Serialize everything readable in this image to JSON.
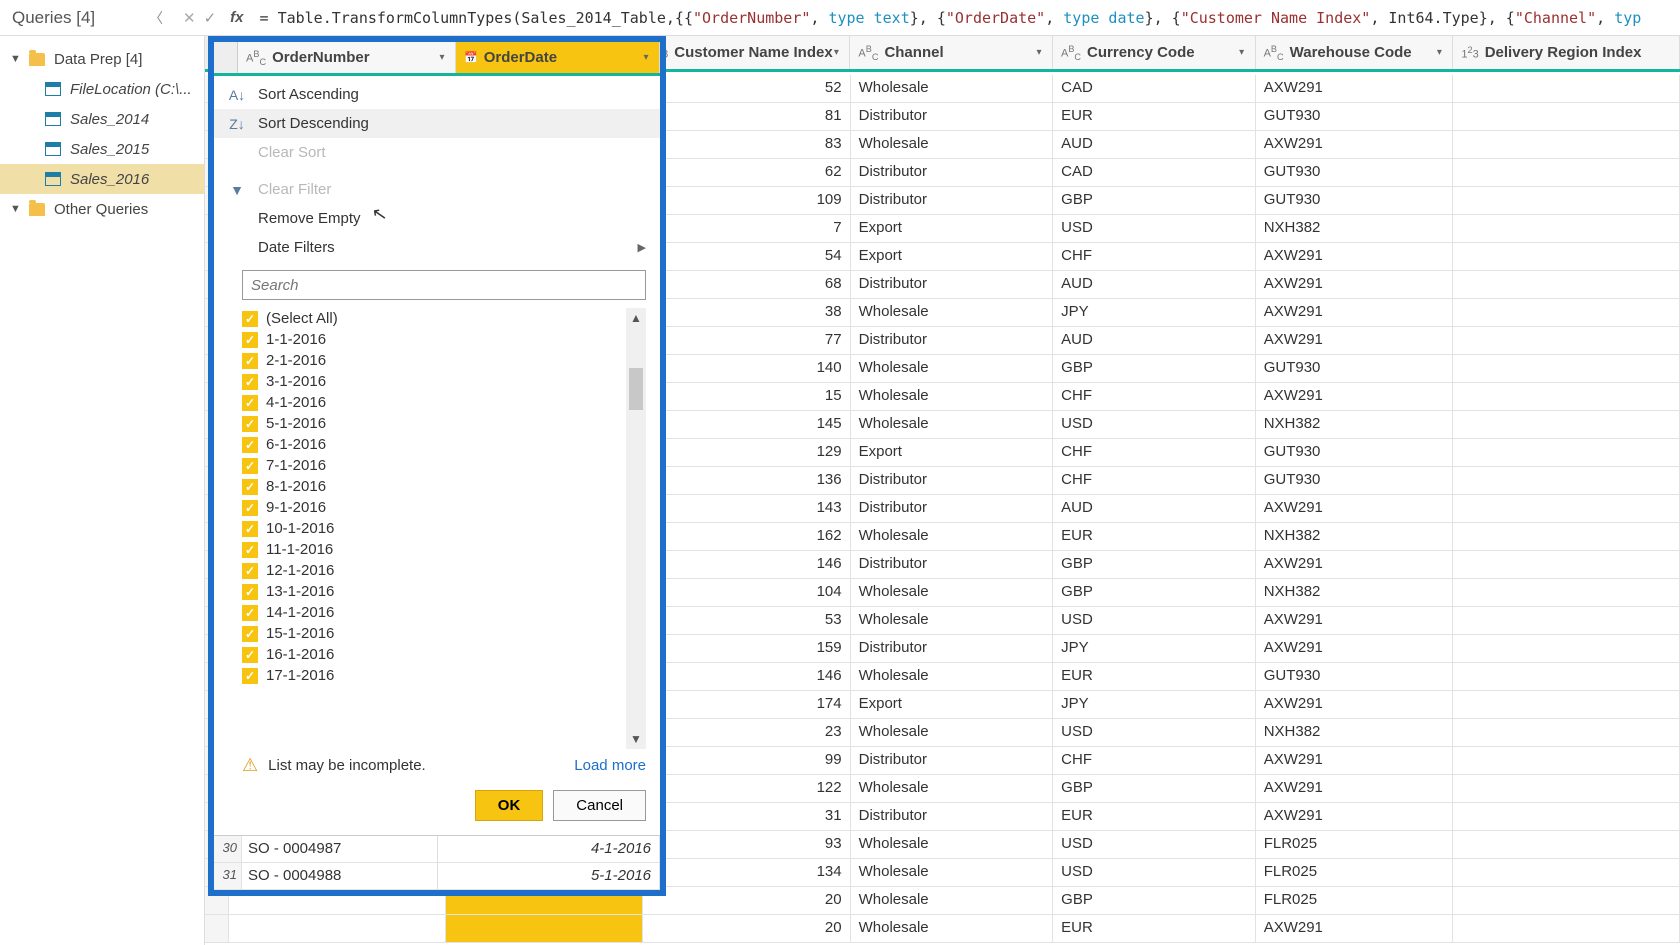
{
  "queries_label": "Queries [4]",
  "sidebar": {
    "folder1": "Data Prep [4]",
    "items": [
      "FileLocation (C:\\...",
      "Sales_2014",
      "Sales_2015",
      "Sales_2016"
    ],
    "folder2": "Other Queries"
  },
  "formula_parts": {
    "eq": "= ",
    "fn": "Table.TransformColumnTypes",
    "p1": "(Sales_2014_Table,{{",
    "s1": "\"OrderNumber\"",
    "c1": ", ",
    "t1": "type text",
    "p2": "}, {",
    "s2": "\"OrderDate\"",
    "t2": "type date",
    "s3": "\"Customer Name Index\"",
    "t3": "Int64.Type",
    "s4": "\"Channel\"",
    "t4": "typ"
  },
  "columns": {
    "c1": "OrderNumber",
    "c2": "OrderDate",
    "c3": "Customer Name Index",
    "c4": "Channel",
    "c5": "Currency Code",
    "c6": "Warehouse Code",
    "c7": "Delivery Region Index",
    "abc": "ABC",
    "num": "1²3",
    "cal": "📅"
  },
  "filter": {
    "sort_asc": "Sort Ascending",
    "sort_desc": "Sort Descending",
    "clear_sort": "Clear Sort",
    "clear_filter": "Clear Filter",
    "remove_empty": "Remove Empty",
    "date_filters": "Date Filters",
    "search_ph": "Search",
    "select_all": "(Select All)",
    "dates": [
      "1-1-2016",
      "2-1-2016",
      "3-1-2016",
      "4-1-2016",
      "5-1-2016",
      "6-1-2016",
      "7-1-2016",
      "8-1-2016",
      "9-1-2016",
      "10-1-2016",
      "11-1-2016",
      "12-1-2016",
      "13-1-2016",
      "14-1-2016",
      "15-1-2016",
      "16-1-2016",
      "17-1-2016"
    ],
    "warn": "List may be incomplete.",
    "load_more": "Load more",
    "ok": "OK",
    "cancel": "Cancel",
    "foot_rows": [
      {
        "n": "30",
        "so": "SO - 0004987",
        "d": "4-1-2016"
      },
      {
        "n": "31",
        "so": "SO - 0004988",
        "d": "5-1-2016"
      }
    ]
  },
  "rows": [
    {
      "idx": 52,
      "ch": "Wholesale",
      "cur": "CAD",
      "wh": "AXW291"
    },
    {
      "idx": 81,
      "ch": "Distributor",
      "cur": "EUR",
      "wh": "GUT930"
    },
    {
      "idx": 83,
      "ch": "Wholesale",
      "cur": "AUD",
      "wh": "AXW291"
    },
    {
      "idx": 62,
      "ch": "Distributor",
      "cur": "CAD",
      "wh": "GUT930"
    },
    {
      "idx": 109,
      "ch": "Distributor",
      "cur": "GBP",
      "wh": "GUT930"
    },
    {
      "idx": 7,
      "ch": "Export",
      "cur": "USD",
      "wh": "NXH382"
    },
    {
      "idx": 54,
      "ch": "Export",
      "cur": "CHF",
      "wh": "AXW291"
    },
    {
      "idx": 68,
      "ch": "Distributor",
      "cur": "AUD",
      "wh": "AXW291"
    },
    {
      "idx": 38,
      "ch": "Wholesale",
      "cur": "JPY",
      "wh": "AXW291"
    },
    {
      "idx": 77,
      "ch": "Distributor",
      "cur": "AUD",
      "wh": "AXW291"
    },
    {
      "idx": 140,
      "ch": "Wholesale",
      "cur": "GBP",
      "wh": "GUT930"
    },
    {
      "idx": 15,
      "ch": "Wholesale",
      "cur": "CHF",
      "wh": "AXW291"
    },
    {
      "idx": 145,
      "ch": "Wholesale",
      "cur": "USD",
      "wh": "NXH382"
    },
    {
      "idx": 129,
      "ch": "Export",
      "cur": "CHF",
      "wh": "GUT930"
    },
    {
      "idx": 136,
      "ch": "Distributor",
      "cur": "CHF",
      "wh": "GUT930"
    },
    {
      "idx": 143,
      "ch": "Distributor",
      "cur": "AUD",
      "wh": "AXW291"
    },
    {
      "idx": 162,
      "ch": "Wholesale",
      "cur": "EUR",
      "wh": "NXH382"
    },
    {
      "idx": 146,
      "ch": "Distributor",
      "cur": "GBP",
      "wh": "AXW291"
    },
    {
      "idx": 104,
      "ch": "Wholesale",
      "cur": "GBP",
      "wh": "NXH382"
    },
    {
      "idx": 53,
      "ch": "Wholesale",
      "cur": "USD",
      "wh": "AXW291"
    },
    {
      "idx": 159,
      "ch": "Distributor",
      "cur": "JPY",
      "wh": "AXW291"
    },
    {
      "idx": 146,
      "ch": "Wholesale",
      "cur": "EUR",
      "wh": "GUT930"
    },
    {
      "idx": 174,
      "ch": "Export",
      "cur": "JPY",
      "wh": "AXW291"
    },
    {
      "idx": 23,
      "ch": "Wholesale",
      "cur": "USD",
      "wh": "NXH382"
    },
    {
      "idx": 99,
      "ch": "Distributor",
      "cur": "CHF",
      "wh": "AXW291"
    },
    {
      "idx": 122,
      "ch": "Wholesale",
      "cur": "GBP",
      "wh": "AXW291"
    },
    {
      "idx": 31,
      "ch": "Distributor",
      "cur": "EUR",
      "wh": "AXW291"
    },
    {
      "idx": 93,
      "ch": "Wholesale",
      "cur": "USD",
      "wh": "FLR025"
    },
    {
      "idx": 134,
      "ch": "Wholesale",
      "cur": "USD",
      "wh": "FLR025"
    },
    {
      "idx": 20,
      "ch": "Wholesale",
      "cur": "GBP",
      "wh": "FLR025"
    },
    {
      "idx": 20,
      "ch": "Wholesale",
      "cur": "EUR",
      "wh": "AXW291"
    }
  ]
}
